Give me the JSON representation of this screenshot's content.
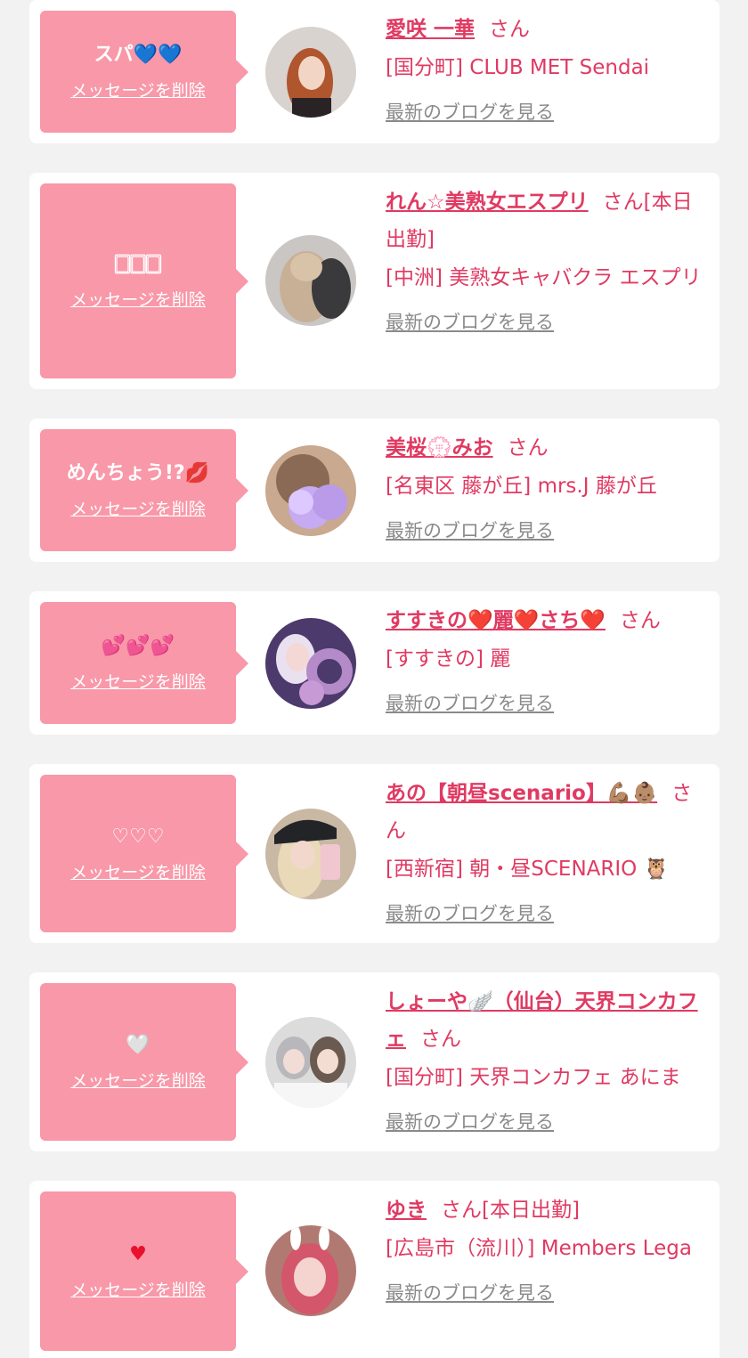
{
  "colors": {
    "accent": "#e03a62",
    "bubble": "#f898a8",
    "background": "#f2f2f2",
    "blog_link": "#8a8a8a"
  },
  "delete_label": "メッセージを削除",
  "blog_label": "最新のブログを見る",
  "san": "さん",
  "items": [
    {
      "message": "スパ💙💙",
      "name": "愛咲 一華",
      "status": "",
      "shop": "[国分町] CLUB MET Sendai"
    },
    {
      "message": "🀆🀆🀆",
      "name": "れん☆美熟女エスプリ",
      "status": "[本日出勤]",
      "shop": "[中洲] 美熟女キャバクラ エスプリ"
    },
    {
      "message": "めんちょう!?💋",
      "name": "美桜💮みお",
      "status": "",
      "shop": "[名東区 藤が丘] mrs.J 藤が丘"
    },
    {
      "message": "💕💕💕",
      "name": "すすきの❤️麗❤️さち❤️",
      "status": "",
      "shop": "[すすきの] 麗"
    },
    {
      "message": "♡♡♡",
      "name": "あの【朝昼scenario】💪🏽👶🏽",
      "status": "",
      "shop": "[西新宿] 朝・昼SCENARIO 🦉"
    },
    {
      "message": "🤍",
      "name": "しょーや🪽（仙台）天界コンカフェ",
      "status": "",
      "shop": "[国分町] 天界コンカフェ あにま"
    },
    {
      "message": "♥",
      "name": "ゆき",
      "status": "[本日出勤]",
      "shop": "[広島市（流川）] Members Lega"
    }
  ]
}
